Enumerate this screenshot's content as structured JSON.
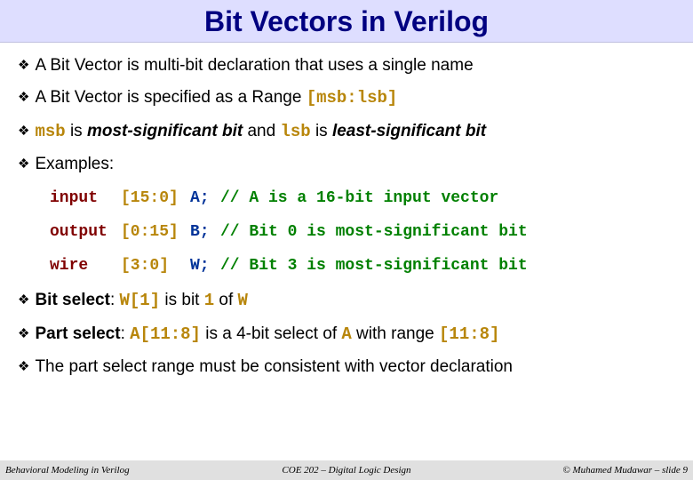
{
  "title": "Bit Vectors in Verilog",
  "bullets": {
    "b1": "A Bit Vector is multi-bit declaration that uses a single name",
    "b2a": "A Bit Vector is specified as a Range ",
    "b2code": "[msb:lsb]",
    "b3_msb": "msb",
    "b3_txt1": " is ",
    "b3_em1": "most-significant bit",
    "b3_txt2": " and ",
    "b3_lsb": "lsb",
    "b3_txt3": " is ",
    "b3_em2": "least-significant bit",
    "b4": "Examples:",
    "b5a": "Bit select",
    "b5b": ": ",
    "b5c": "W[1]",
    "b5d": " is bit ",
    "b5e": "1",
    "b5f": " of ",
    "b5g": "W",
    "b6a": "Part select",
    "b6b": ": ",
    "b6c": "A[11:8]",
    "b6d": " is a 4-bit select of ",
    "b6e": "A",
    "b6f": " with range ",
    "b6g": "[11:8]",
    "b7": "The part select range must be consistent with vector declaration"
  },
  "examples": [
    {
      "kw": "input",
      "rng": "[15:0]",
      "nm": "A;",
      "cmt": "// A is a 16-bit input vector"
    },
    {
      "kw": "output",
      "rng": "[0:15]",
      "nm": "B;",
      "cmt": "// Bit 0 is most-significant bit"
    },
    {
      "kw": "wire",
      "rng": "[3:0]",
      "nm": "W;",
      "cmt": "// Bit 3 is most-significant bit"
    }
  ],
  "footer": {
    "left": "Behavioral Modeling in Verilog",
    "center": "COE 202 – Digital Logic Design",
    "right": "© Muhamed Mudawar – slide 9"
  }
}
